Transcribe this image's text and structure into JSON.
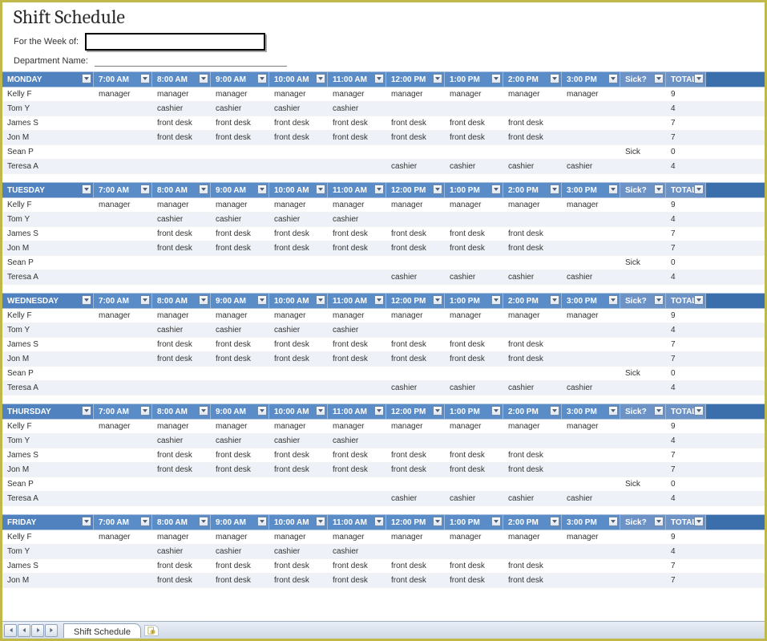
{
  "title": "Shift Schedule",
  "meta": {
    "week_label": "For the Week of:",
    "week_value": "",
    "dept_label": "Department Name:",
    "dept_value": ""
  },
  "columns": {
    "times": [
      "7:00 AM",
      "8:00 AM",
      "9:00 AM",
      "10:00 AM",
      "11:00 AM",
      "12:00 PM",
      "1:00 PM",
      "2:00 PM",
      "3:00 PM"
    ],
    "sick": "Sick?",
    "total": "TOTAL"
  },
  "days": [
    {
      "name": "MONDAY",
      "rows": [
        {
          "name": "Kelly F",
          "slots": [
            "manager",
            "manager",
            "manager",
            "manager",
            "manager",
            "manager",
            "manager",
            "manager",
            "manager"
          ],
          "sick": "",
          "total": "9"
        },
        {
          "name": "Tom Y",
          "slots": [
            "",
            "cashier",
            "cashier",
            "cashier",
            "cashier",
            "",
            "",
            "",
            ""
          ],
          "sick": "",
          "total": "4"
        },
        {
          "name": "James S",
          "slots": [
            "",
            "front desk",
            "front desk",
            "front desk",
            "front desk",
            "front desk",
            "front desk",
            "front desk",
            ""
          ],
          "sick": "",
          "total": "7"
        },
        {
          "name": "Jon M",
          "slots": [
            "",
            "front desk",
            "front desk",
            "front desk",
            "front desk",
            "front desk",
            "front desk",
            "front desk",
            ""
          ],
          "sick": "",
          "total": "7"
        },
        {
          "name": "Sean P",
          "slots": [
            "",
            "",
            "",
            "",
            "",
            "",
            "",
            "",
            ""
          ],
          "sick": "Sick",
          "total": "0"
        },
        {
          "name": "Teresa A",
          "slots": [
            "",
            "",
            "",
            "",
            "",
            "cashier",
            "cashier",
            "cashier",
            "cashier"
          ],
          "sick": "",
          "total": "4"
        }
      ]
    },
    {
      "name": "TUESDAY",
      "rows": [
        {
          "name": "Kelly F",
          "slots": [
            "manager",
            "manager",
            "manager",
            "manager",
            "manager",
            "manager",
            "manager",
            "manager",
            "manager"
          ],
          "sick": "",
          "total": "9"
        },
        {
          "name": "Tom Y",
          "slots": [
            "",
            "cashier",
            "cashier",
            "cashier",
            "cashier",
            "",
            "",
            "",
            ""
          ],
          "sick": "",
          "total": "4"
        },
        {
          "name": "James S",
          "slots": [
            "",
            "front desk",
            "front desk",
            "front desk",
            "front desk",
            "front desk",
            "front desk",
            "front desk",
            ""
          ],
          "sick": "",
          "total": "7"
        },
        {
          "name": "Jon M",
          "slots": [
            "",
            "front desk",
            "front desk",
            "front desk",
            "front desk",
            "front desk",
            "front desk",
            "front desk",
            ""
          ],
          "sick": "",
          "total": "7"
        },
        {
          "name": "Sean P",
          "slots": [
            "",
            "",
            "",
            "",
            "",
            "",
            "",
            "",
            ""
          ],
          "sick": "Sick",
          "total": "0"
        },
        {
          "name": "Teresa A",
          "slots": [
            "",
            "",
            "",
            "",
            "",
            "cashier",
            "cashier",
            "cashier",
            "cashier"
          ],
          "sick": "",
          "total": "4"
        }
      ]
    },
    {
      "name": "WEDNESDAY",
      "rows": [
        {
          "name": "Kelly F",
          "slots": [
            "manager",
            "manager",
            "manager",
            "manager",
            "manager",
            "manager",
            "manager",
            "manager",
            "manager"
          ],
          "sick": "",
          "total": "9"
        },
        {
          "name": "Tom Y",
          "slots": [
            "",
            "cashier",
            "cashier",
            "cashier",
            "cashier",
            "",
            "",
            "",
            ""
          ],
          "sick": "",
          "total": "4"
        },
        {
          "name": "James S",
          "slots": [
            "",
            "front desk",
            "front desk",
            "front desk",
            "front desk",
            "front desk",
            "front desk",
            "front desk",
            ""
          ],
          "sick": "",
          "total": "7"
        },
        {
          "name": "Jon M",
          "slots": [
            "",
            "front desk",
            "front desk",
            "front desk",
            "front desk",
            "front desk",
            "front desk",
            "front desk",
            ""
          ],
          "sick": "",
          "total": "7"
        },
        {
          "name": "Sean P",
          "slots": [
            "",
            "",
            "",
            "",
            "",
            "",
            "",
            "",
            ""
          ],
          "sick": "Sick",
          "total": "0"
        },
        {
          "name": "Teresa A",
          "slots": [
            "",
            "",
            "",
            "",
            "",
            "cashier",
            "cashier",
            "cashier",
            "cashier"
          ],
          "sick": "",
          "total": "4"
        }
      ]
    },
    {
      "name": "THURSDAY",
      "rows": [
        {
          "name": "Kelly F",
          "slots": [
            "manager",
            "manager",
            "manager",
            "manager",
            "manager",
            "manager",
            "manager",
            "manager",
            "manager"
          ],
          "sick": "",
          "total": "9"
        },
        {
          "name": "Tom Y",
          "slots": [
            "",
            "cashier",
            "cashier",
            "cashier",
            "cashier",
            "",
            "",
            "",
            ""
          ],
          "sick": "",
          "total": "4"
        },
        {
          "name": "James S",
          "slots": [
            "",
            "front desk",
            "front desk",
            "front desk",
            "front desk",
            "front desk",
            "front desk",
            "front desk",
            ""
          ],
          "sick": "",
          "total": "7"
        },
        {
          "name": "Jon M",
          "slots": [
            "",
            "front desk",
            "front desk",
            "front desk",
            "front desk",
            "front desk",
            "front desk",
            "front desk",
            ""
          ],
          "sick": "",
          "total": "7"
        },
        {
          "name": "Sean P",
          "slots": [
            "",
            "",
            "",
            "",
            "",
            "",
            "",
            "",
            ""
          ],
          "sick": "Sick",
          "total": "0"
        },
        {
          "name": "Teresa A",
          "slots": [
            "",
            "",
            "",
            "",
            "",
            "cashier",
            "cashier",
            "cashier",
            "cashier"
          ],
          "sick": "",
          "total": "4"
        }
      ]
    },
    {
      "name": "FRIDAY",
      "rows": [
        {
          "name": "Kelly F",
          "slots": [
            "manager",
            "manager",
            "manager",
            "manager",
            "manager",
            "manager",
            "manager",
            "manager",
            "manager"
          ],
          "sick": "",
          "total": "9"
        },
        {
          "name": "Tom Y",
          "slots": [
            "",
            "cashier",
            "cashier",
            "cashier",
            "cashier",
            "",
            "",
            "",
            ""
          ],
          "sick": "",
          "total": "4"
        },
        {
          "name": "James S",
          "slots": [
            "",
            "front desk",
            "front desk",
            "front desk",
            "front desk",
            "front desk",
            "front desk",
            "front desk",
            ""
          ],
          "sick": "",
          "total": "7"
        },
        {
          "name": "Jon M",
          "slots": [
            "",
            "front desk",
            "front desk",
            "front desk",
            "front desk",
            "front desk",
            "front desk",
            "front desk",
            ""
          ],
          "sick": "",
          "total": "7"
        }
      ]
    }
  ],
  "footer": {
    "tab": "Shift Schedule"
  }
}
